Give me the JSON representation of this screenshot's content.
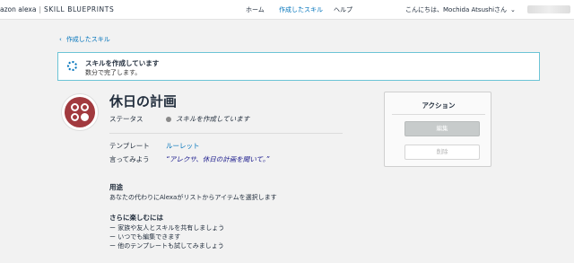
{
  "header": {
    "brand_left": "azon alexa",
    "brand_separator": "|",
    "brand_right": "SKILL BLUEPRINTS",
    "nav": [
      {
        "label": "ホーム",
        "active": false
      },
      {
        "label": "作成したスキル",
        "active": true
      },
      {
        "label": "ヘルプ",
        "active": false
      }
    ],
    "greeting": "こんにちは、Mochida Atsushiさん",
    "chevron_icon": "chevron-down-icon"
  },
  "back_link": {
    "icon": "chevron-left-icon",
    "label": "作成したスキル"
  },
  "banner": {
    "icon": "spinner-icon",
    "title": "スキルを作成しています",
    "subtitle": "数分で完了します。"
  },
  "skill": {
    "title": "休日の計画",
    "status_label": "ステータス",
    "status_value": "スキルを作成しています",
    "template_label": "テンプレート",
    "template_value": "ルーレット",
    "try_label": "言ってみよう",
    "try_value": "“アレクサ、休日の計画を聞いて。”"
  },
  "usage": {
    "heading": "用途",
    "text": "あなたの代わりにAlexaがリストからアイテムを選択します"
  },
  "more": {
    "heading": "さらに楽しむには",
    "items": [
      "ー 家族や友人とスキルを共有しましょう",
      "ー いつでも編集できます",
      "ー 他のテンプレートも試してみましょう"
    ]
  },
  "actions": {
    "title": "アクション",
    "edit_label": "編集",
    "delete_label": "削除"
  },
  "colors": {
    "accent": "#0073bb",
    "logo": "#a23a3f",
    "banner_border": "#6cc4d6"
  }
}
